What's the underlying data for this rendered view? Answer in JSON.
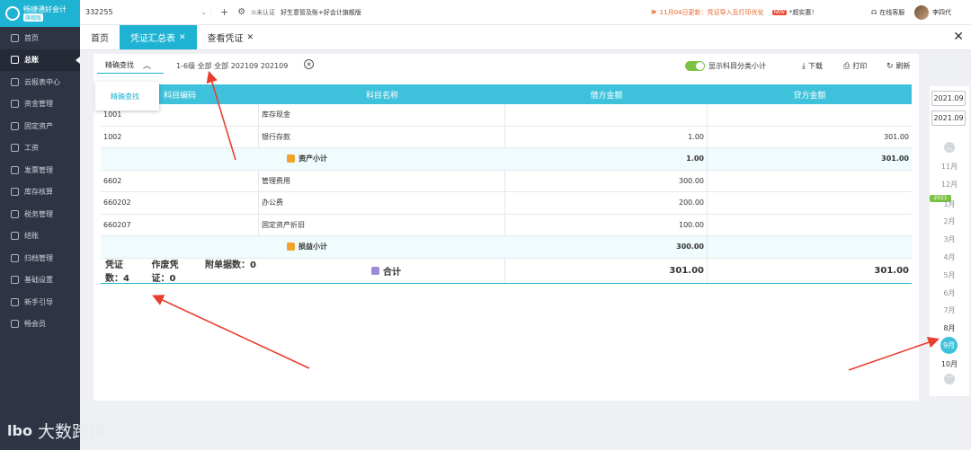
{
  "sidebar": {
    "logo_title": "畅捷通好会计",
    "logo_sub": "旗舰版",
    "items": [
      {
        "label": "首页",
        "icon": "home-icon"
      },
      {
        "label": "总账",
        "icon": "ledger-icon",
        "active": true
      },
      {
        "label": "云报表中心",
        "icon": "report-icon"
      },
      {
        "label": "资金管理",
        "icon": "funds-icon"
      },
      {
        "label": "固定资产",
        "icon": "asset-icon"
      },
      {
        "label": "工资",
        "icon": "salary-icon"
      },
      {
        "label": "发票管理",
        "icon": "invoice-icon"
      },
      {
        "label": "库存核算",
        "icon": "inventory-icon"
      },
      {
        "label": "税务管理",
        "icon": "tax-icon"
      },
      {
        "label": "结账",
        "icon": "closing-icon"
      },
      {
        "label": "归档管理",
        "icon": "archive-icon"
      },
      {
        "label": "基础设置",
        "icon": "settings-icon"
      },
      {
        "label": "新手引导",
        "icon": "guide-icon"
      },
      {
        "label": "畅会员",
        "icon": "vip-icon"
      }
    ]
  },
  "topbar": {
    "company": "332255",
    "add_label": "+",
    "unverified": "未认证",
    "promo_text": "好生意管及账+好会计旗舰版",
    "notice": "11月04日更新：凭证导入及打印优化",
    "promo2": "*超实惠！",
    "service": "在线客服",
    "user": "李四代"
  },
  "tabs": [
    {
      "label": "首页",
      "active": false,
      "closable": false
    },
    {
      "label": "凭证汇总表",
      "active": true,
      "closable": true
    },
    {
      "label": "查看凭证",
      "active": false,
      "closable": true
    }
  ],
  "toolbar": {
    "search_label": "精确查找",
    "filter_text": "1-6级  全部 全部 202109 202109",
    "toggle_label": "显示科目分类小计",
    "download": "下载",
    "print": "打印",
    "refresh": "刷新"
  },
  "dropdown": {
    "item": "精确查找"
  },
  "table": {
    "headers": [
      "科目编码",
      "科目名称",
      "借方金额",
      "贷方金额"
    ],
    "rows": [
      {
        "type": "data",
        "code": "1001",
        "name": "库存现金",
        "debit": "",
        "credit": ""
      },
      {
        "type": "data",
        "code": "1002",
        "name": "银行存款",
        "debit": "1.00",
        "credit": "301.00"
      },
      {
        "type": "subtotal",
        "label": "资产小计",
        "debit": "1.00",
        "credit": "301.00"
      },
      {
        "type": "data",
        "code": "6602",
        "name": "管理费用",
        "debit": "300.00",
        "credit": ""
      },
      {
        "type": "data",
        "code": "660202",
        "name": "办公费",
        "debit": "200.00",
        "credit": ""
      },
      {
        "type": "data",
        "code": "660207",
        "name": "固定资产折旧",
        "debit": "100.00",
        "credit": ""
      },
      {
        "type": "subtotal",
        "label": "损益小计",
        "debit": "300.00",
        "credit": ""
      }
    ],
    "footer": {
      "voucher_count": "凭证数：4",
      "void_count": "作废凭证：0",
      "attach_count": "附单据数：0",
      "total_label": "合计",
      "debit": "301.00",
      "credit": "301.00"
    }
  },
  "datepicker": {
    "start": "2021.09",
    "end": "2021.09",
    "year_tag": "2021",
    "months_before": [
      "11月",
      "12月"
    ],
    "months": [
      "1月",
      "2月",
      "3月",
      "4月",
      "5月",
      "6月",
      "7月",
      "8月",
      "9月",
      "10月"
    ],
    "selected": "9月"
  },
  "watermark": {
    "logo": "lbo",
    "text": "大数跨境"
  },
  "colors": {
    "accent": "#1fb3d3",
    "header": "#3ec2dc",
    "sidebar": "#2e3444",
    "arrow": "#e8402f",
    "toggle": "#7bc142"
  }
}
